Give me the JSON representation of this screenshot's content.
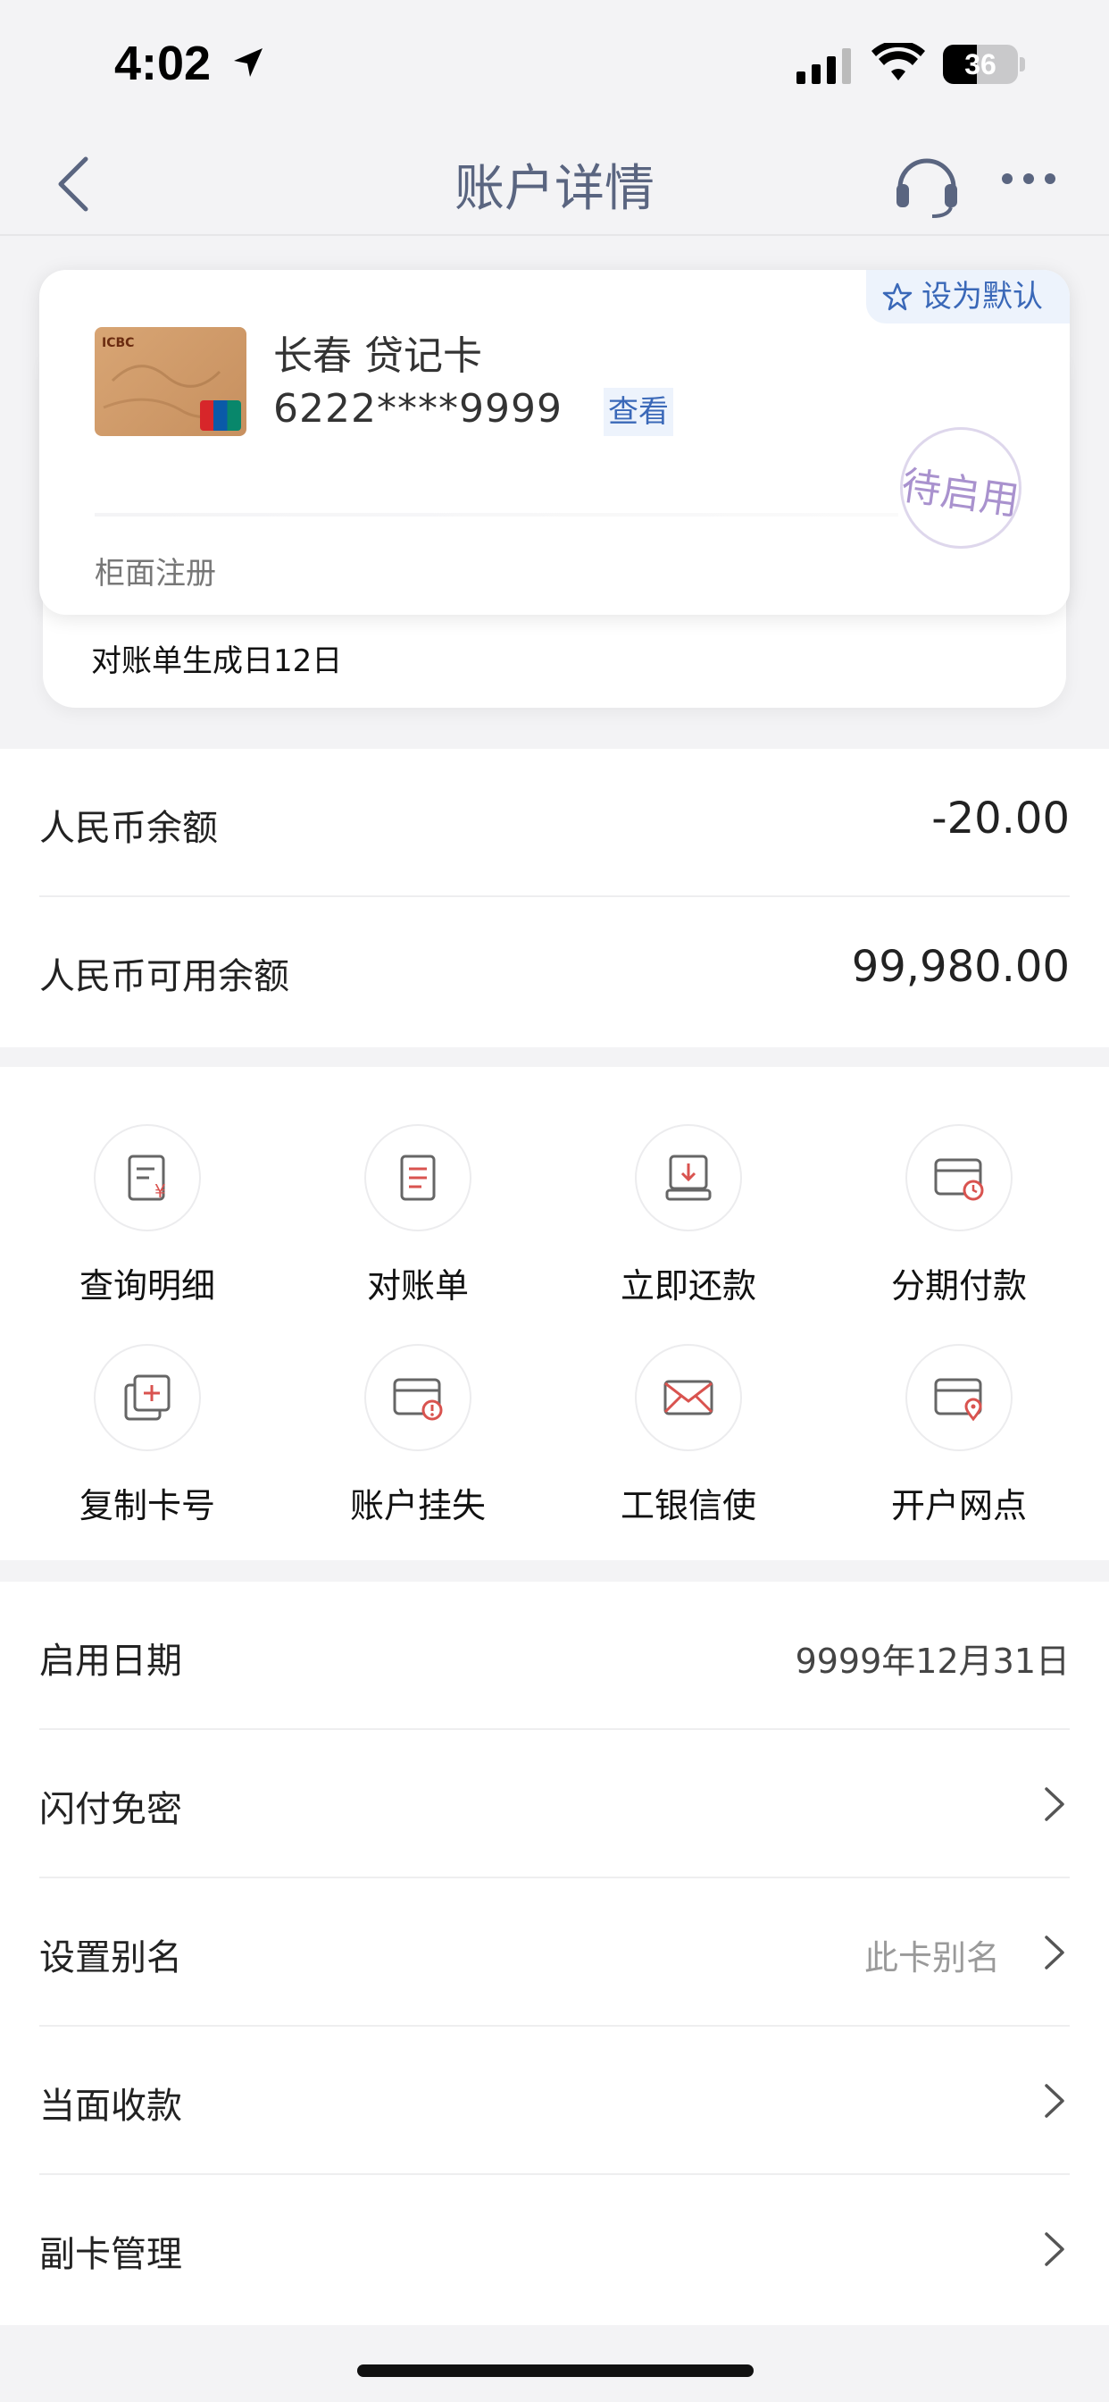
{
  "status_bar": {
    "time": "4:02",
    "battery": "36"
  },
  "nav": {
    "title": "账户详情"
  },
  "card": {
    "default_label": "设为默认",
    "thumb_brand": "ICBC",
    "name": "长春 贷记卡",
    "number": "6222****9999",
    "view_label": "查看",
    "stamp": "待启用",
    "register": "柜面注册",
    "statement_day": "对账单生成日12日"
  },
  "balances": [
    {
      "label": "人民币余额",
      "value": "-20.00"
    },
    {
      "label": "人民币可用余额",
      "value": "99,980.00"
    }
  ],
  "actions": [
    {
      "label": "查询明细",
      "icon": "detail-yuan-icon"
    },
    {
      "label": "对账单",
      "icon": "statement-icon"
    },
    {
      "label": "立即还款",
      "icon": "repay-icon"
    },
    {
      "label": "分期付款",
      "icon": "installment-icon"
    },
    {
      "label": "复制卡号",
      "icon": "copy-card-icon"
    },
    {
      "label": "账户挂失",
      "icon": "report-loss-icon"
    },
    {
      "label": "工银信使",
      "icon": "message-envelope-icon"
    },
    {
      "label": "开户网点",
      "icon": "branch-location-icon"
    }
  ],
  "settings": [
    {
      "label": "启用日期",
      "value": "9999年12月31日"
    },
    {
      "label": "闪付免密"
    },
    {
      "label": "设置别名",
      "hint": "此卡别名"
    },
    {
      "label": "当面收款"
    },
    {
      "label": "副卡管理"
    }
  ],
  "colors": {
    "accent": "#3a68b8",
    "icon_red": "#d9534f",
    "title": "#5a6580"
  }
}
